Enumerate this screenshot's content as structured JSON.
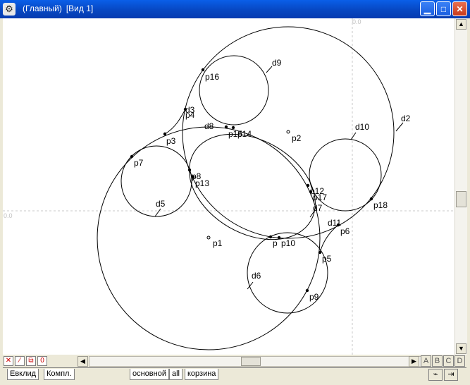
{
  "window": {
    "title_parts": [
      "(Главный)",
      "[Вид 1]"
    ],
    "minimize_glyph": "▁",
    "maximize_glyph": "□",
    "close_glyph": "✕",
    "app_icon_glyph": "⚙"
  },
  "canvas": {
    "axis_label_top": "0.0",
    "axis_label_left": "0.0",
    "labels": [
      {
        "id": "p1",
        "text": "p1"
      },
      {
        "id": "p2",
        "text": "p2"
      },
      {
        "id": "p3",
        "text": "p3"
      },
      {
        "id": "p4",
        "text": "p4"
      },
      {
        "id": "d3",
        "text": "d3"
      },
      {
        "id": "p5",
        "text": "p5"
      },
      {
        "id": "p6",
        "text": "p6"
      },
      {
        "id": "p7",
        "text": "p7"
      },
      {
        "id": "p8",
        "text": "p8"
      },
      {
        "id": "p9",
        "text": "p9"
      },
      {
        "id": "p10",
        "text": "p10"
      },
      {
        "id": "pxa",
        "text": "p"
      },
      {
        "id": "p12",
        "text": "p12"
      },
      {
        "id": "p13",
        "text": "p13"
      },
      {
        "id": "p14",
        "text": "p14"
      },
      {
        "id": "p15",
        "text": "p15"
      },
      {
        "id": "p16",
        "text": "p16"
      },
      {
        "id": "p17",
        "text": "p17"
      },
      {
        "id": "p18",
        "text": "p18"
      },
      {
        "id": "d2",
        "text": "d2"
      },
      {
        "id": "d5",
        "text": "d5"
      },
      {
        "id": "d6",
        "text": "d6"
      },
      {
        "id": "d7",
        "text": "d7"
      },
      {
        "id": "d8",
        "text": "d8"
      },
      {
        "id": "d9",
        "text": "d9"
      },
      {
        "id": "d10",
        "text": "d10"
      },
      {
        "id": "d11",
        "text": "d11"
      }
    ]
  },
  "bottom_toolbar": {
    "cancel_glyph": "✕",
    "line_glyph": "⁄",
    "copy_glyph": "⧉",
    "zero_label": "0",
    "left_arrow": "◀",
    "right_arrow": "▶",
    "letters": [
      "A",
      "B",
      "C",
      "D"
    ]
  },
  "scrollbar": {
    "up": "▲",
    "down": "▼"
  },
  "tabs": [
    {
      "label": "Евклид"
    },
    {
      "label": "Компл."
    },
    {
      "label": "основной"
    },
    {
      "label": "all"
    },
    {
      "label": "корзина"
    }
  ],
  "tool_buttons": {
    "pen_glyph": "⌁",
    "arrow_glyph": "⇥"
  }
}
